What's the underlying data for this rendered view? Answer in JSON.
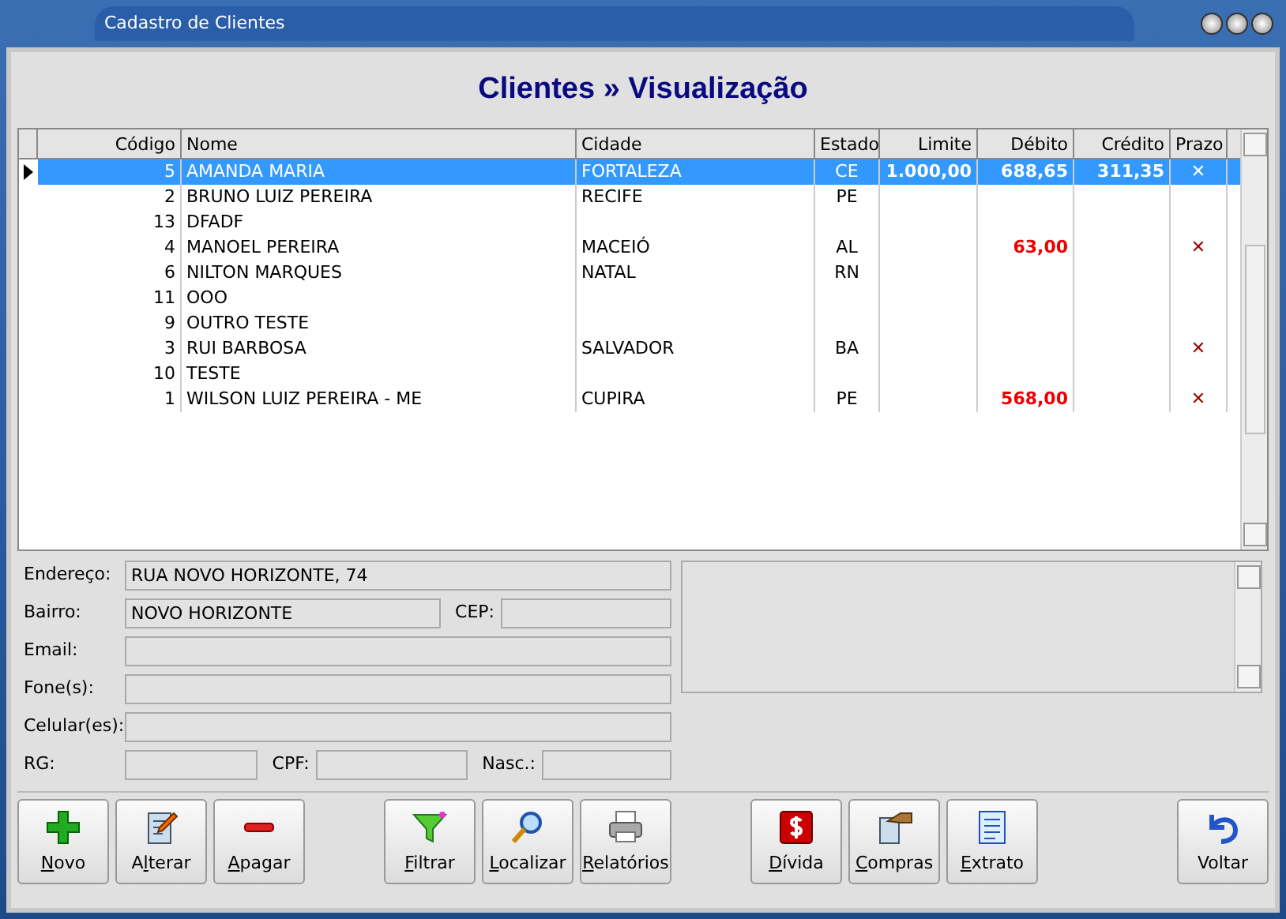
{
  "window": {
    "title": "Cadastro de Clientes"
  },
  "heading": "Clientes » Visualização",
  "table": {
    "columns": [
      "Código",
      "Nome",
      "Cidade",
      "Estado",
      "Limite",
      "Débito",
      "Crédito",
      "Prazo"
    ],
    "rows": [
      {
        "codigo": "5",
        "nome": "AMANDA MARIA",
        "cidade": "FORTALEZA",
        "estado": "CE",
        "limite": "1.000,00",
        "debito": "688,65",
        "credito": "311,35",
        "prazo": true,
        "selected": true
      },
      {
        "codigo": "2",
        "nome": "BRUNO LUIZ PEREIRA",
        "cidade": "RECIFE",
        "estado": "PE",
        "limite": "",
        "debito": "",
        "credito": "",
        "prazo": false,
        "selected": false
      },
      {
        "codigo": "13",
        "nome": "DFADF",
        "cidade": "",
        "estado": "",
        "limite": "",
        "debito": "",
        "credito": "",
        "prazo": false,
        "selected": false
      },
      {
        "codigo": "4",
        "nome": "MANOEL PEREIRA",
        "cidade": "MACEIÓ",
        "estado": "AL",
        "limite": "",
        "debito": "63,00",
        "credito": "",
        "prazo": true,
        "selected": false
      },
      {
        "codigo": "6",
        "nome": "NILTON MARQUES",
        "cidade": "NATAL",
        "estado": "RN",
        "limite": "",
        "debito": "",
        "credito": "",
        "prazo": false,
        "selected": false
      },
      {
        "codigo": "11",
        "nome": "OOO",
        "cidade": "",
        "estado": "",
        "limite": "",
        "debito": "",
        "credito": "",
        "prazo": false,
        "selected": false
      },
      {
        "codigo": "9",
        "nome": "OUTRO TESTE",
        "cidade": "",
        "estado": "",
        "limite": "",
        "debito": "",
        "credito": "",
        "prazo": false,
        "selected": false
      },
      {
        "codigo": "3",
        "nome": "RUI BARBOSA",
        "cidade": "SALVADOR",
        "estado": "BA",
        "limite": "",
        "debito": "",
        "credito": "",
        "prazo": true,
        "selected": false
      },
      {
        "codigo": "10",
        "nome": "TESTE",
        "cidade": "",
        "estado": "",
        "limite": "",
        "debito": "",
        "credito": "",
        "prazo": false,
        "selected": false
      },
      {
        "codigo": "1",
        "nome": "WILSON LUIZ PEREIRA - ME",
        "cidade": "CUPIRA",
        "estado": "PE",
        "limite": "",
        "debito": "568,00",
        "credito": "",
        "prazo": true,
        "selected": false
      }
    ]
  },
  "prazo_mark": "✕",
  "details": {
    "endereco": {
      "label": "Endereço:",
      "value": "RUA NOVO HORIZONTE, 74"
    },
    "bairro": {
      "label": "Bairro:",
      "value": "NOVO HORIZONTE"
    },
    "cep": {
      "label": "CEP:"
    },
    "email": {
      "label": "Email:"
    },
    "fones": {
      "label": "Fone(s):"
    },
    "celulares": {
      "label": "Celular(es):"
    },
    "rg": {
      "label": "RG:"
    },
    "cpf": {
      "label": "CPF:"
    },
    "nasc": {
      "label": "Nasc.:"
    }
  },
  "buttons": [
    {
      "label": "Novo"
    },
    {
      "label": "Alterar"
    },
    {
      "label": "Apagar"
    },
    {
      "label": "Filtrar"
    },
    {
      "label": "Localizar"
    },
    {
      "label": "Relatórios"
    },
    {
      "label": "Dívida"
    },
    {
      "label": "Compras"
    },
    {
      "label": "Extrato"
    },
    {
      "label": "Voltar"
    }
  ]
}
